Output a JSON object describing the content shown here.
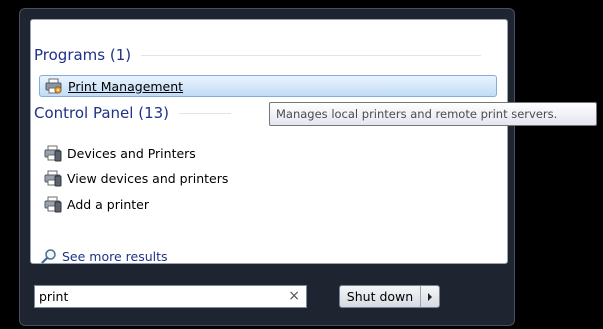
{
  "results": {
    "programs_header": "Programs (1)",
    "programs": [
      {
        "label": "Print Management",
        "icon": "print-management-icon"
      }
    ],
    "control_panel_header": "Control Panel (13)",
    "control_panel": [
      {
        "label": "Devices and Printers",
        "icon": "printer-icon"
      },
      {
        "label": "View devices and printers",
        "icon": "printer-icon"
      },
      {
        "label": "Add a printer",
        "icon": "printer-icon"
      }
    ],
    "see_more": "See more results"
  },
  "search": {
    "value": "print",
    "clear_glyph": "×"
  },
  "shutdown": {
    "label": "Shut down"
  },
  "tooltip": {
    "text": "Manages local printers and remote print servers."
  },
  "colors": {
    "header_text": "#1e3287",
    "selected_border": "#84acdd",
    "menu_frame": "#1e2530"
  }
}
